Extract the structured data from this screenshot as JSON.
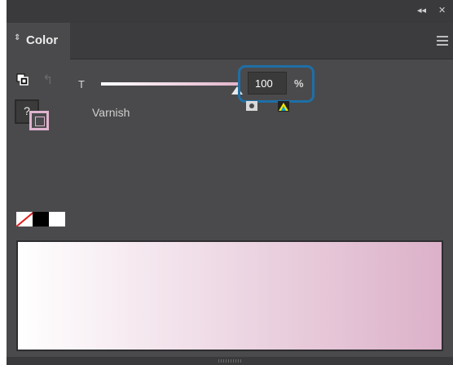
{
  "window": {
    "collapse_glyph": "◂◂",
    "close_glyph": "✕"
  },
  "tab": {
    "arrows_glyph": "⇕",
    "label": "Color"
  },
  "controls": {
    "fill_glyph": "?",
    "tint_label": "T",
    "tint_value": "100",
    "tint_unit": "%",
    "swatch_name": "Varnish",
    "tint_level_percent": 100
  },
  "colors": {
    "panel_bg": "#4a4a4c",
    "accent_highlight": "#1e6fa6",
    "swatch_color": "#dcb1c9"
  },
  "icons": [
    "collapse-icon",
    "close-icon",
    "panel-menu-icon",
    "fill-stroke-default-icon",
    "swap-icon",
    "spot-color-icon",
    "color-mode-icon"
  ]
}
